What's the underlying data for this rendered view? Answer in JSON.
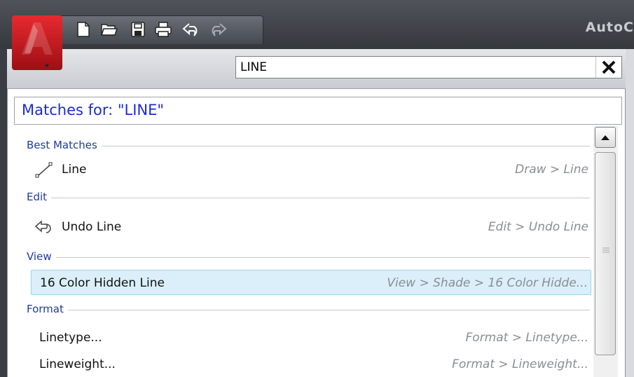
{
  "app": {
    "title": "AutoC"
  },
  "quick_access": [
    "new-icon",
    "open-icon",
    "save-icon",
    "print-icon",
    "undo-icon",
    "redo-icon"
  ],
  "search": {
    "value": "LINE"
  },
  "results": {
    "header": "Matches for: \"LINE\"",
    "groups": [
      {
        "title": "Best Matches",
        "items": [
          {
            "label": "Line",
            "path": "Draw > Line",
            "icon": "line-icon"
          }
        ]
      },
      {
        "title": "Edit",
        "items": [
          {
            "label": "Undo Line",
            "path": "Edit > Undo Line",
            "icon": "undo-icon"
          }
        ]
      },
      {
        "title": "View",
        "items": [
          {
            "label": "16 Color Hidden Line",
            "path": "View > Shade > 16 Color Hidde...",
            "selected": true
          }
        ]
      },
      {
        "title": "Format",
        "items": [
          {
            "label": "Linetype...",
            "path": "Format > Linetype..."
          },
          {
            "label": "Lineweight...",
            "path": "Format > Lineweight..."
          }
        ]
      }
    ]
  },
  "colors": {
    "accent_header": "#1d2bd6",
    "group_title": "#1d3c9c",
    "selection": "#dbeffa",
    "logo": "#c8161d"
  }
}
